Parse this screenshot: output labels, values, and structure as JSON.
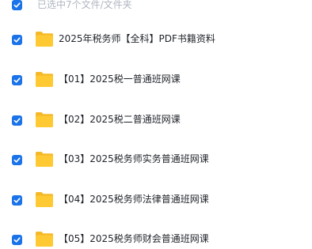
{
  "header": {
    "selection_text": "已选中7个文件/文件夹"
  },
  "files": [
    {
      "name": "2025年税务师【全科】PDF书籍资料",
      "checked": true,
      "icon": "folder-icon"
    },
    {
      "name": "【01】2025税一普通班网课",
      "checked": true,
      "icon": "folder-icon"
    },
    {
      "name": "【02】2025税二普通班网课",
      "checked": true,
      "icon": "folder-icon"
    },
    {
      "name": "【03】2025税务师实务普通班网课",
      "checked": true,
      "icon": "folder-icon"
    },
    {
      "name": "【04】2025税务师法律普通班网课",
      "checked": true,
      "icon": "folder-icon"
    },
    {
      "name": "【05】2025税务师财会普通班网课",
      "checked": true,
      "icon": "folder-icon"
    }
  ],
  "colors": {
    "checkbox": "#1a73e8",
    "folder": "#ffc933",
    "folder_back": "#f5b829",
    "header_text": "#b0b6bf",
    "row_text": "#1f2329"
  }
}
